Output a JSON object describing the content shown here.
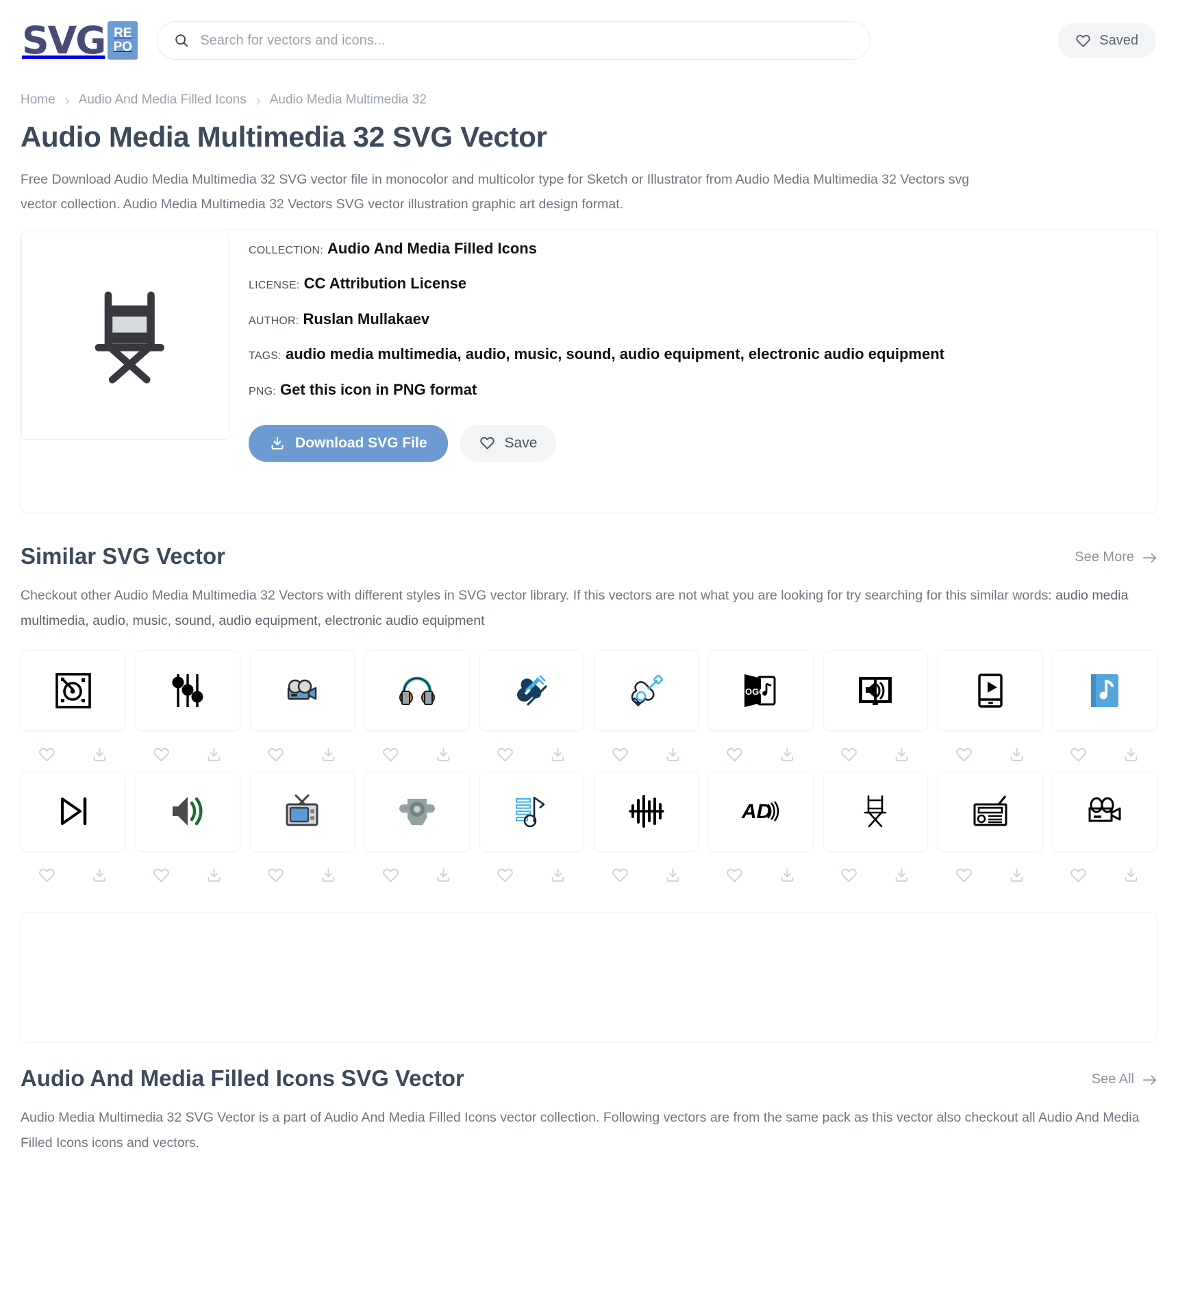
{
  "header": {
    "logo_text": "SVG",
    "logo_badge_top": "RE",
    "logo_badge_bottom": "PO",
    "search_placeholder": "Search for vectors and icons...",
    "search_value": "",
    "saved_label": "Saved"
  },
  "breadcrumb": {
    "home": "Home",
    "collection": "Audio And Media Filled Icons",
    "current": "Audio Media Multimedia 32"
  },
  "page": {
    "title": "Audio Media Multimedia 32 SVG Vector",
    "description": "Free Download Audio Media Multimedia 32 SVG vector file in monocolor and multicolor type for Sketch or Illustrator from Audio Media Multimedia 32 Vectors svg vector collection. Audio Media Multimedia 32 Vectors SVG vector illustration graphic art design format."
  },
  "detail": {
    "collection_label": "COLLECTION:",
    "collection_value": "Audio And Media Filled Icons",
    "license_label": "LICENSE:",
    "license_value": "CC Attribution License",
    "author_label": "AUTHOR:",
    "author_value": "Ruslan Mullakaev",
    "tags_label": "TAGS:",
    "tags_value": "audio media multimedia, audio, music, sound, audio equipment, electronic audio equipment",
    "png_label": "PNG:",
    "png_value": "Get this icon in PNG format",
    "download_label": "Download SVG File",
    "save_label": "Save",
    "preview_icon": "directors-chair-icon"
  },
  "similar": {
    "title": "Similar SVG Vector",
    "see_more": "See More",
    "description_part1": "Checkout other Audio Media Multimedia 32 Vectors with different styles in SVG vector library. If this vectors are not what you are looking for try searching for this similar words: ",
    "description_keywords": "audio media multimedia, audio, music, sound, audio equipment, electronic audio equipment",
    "icons": [
      {
        "name": "turntable-icon"
      },
      {
        "name": "equalizer-sliders-icon"
      },
      {
        "name": "video-camera-icon"
      },
      {
        "name": "headphones-icon"
      },
      {
        "name": "violin-icon"
      },
      {
        "name": "acoustic-guitar-icon"
      },
      {
        "name": "ogg-audio-file-icon"
      },
      {
        "name": "audio-book-speaker-icon"
      },
      {
        "name": "tablet-video-play-icon"
      },
      {
        "name": "music-note-book-icon"
      },
      {
        "name": "play-next-track-icon"
      },
      {
        "name": "volume-speaker-icon"
      },
      {
        "name": "retro-television-icon"
      },
      {
        "name": "audio-jack-connector-icon"
      },
      {
        "name": "music-playlist-note-icon"
      },
      {
        "name": "audio-waveform-icon"
      },
      {
        "name": "audio-description-icon"
      },
      {
        "name": "directors-chair-icon"
      },
      {
        "name": "radio-receiver-icon"
      },
      {
        "name": "movie-camera-outline-icon"
      }
    ],
    "favorite_label": "Favorite",
    "download_label": "Download"
  },
  "collection_section": {
    "title": "Audio And Media Filled Icons SVG Vector",
    "see_all": "See All",
    "description": "Audio Media Multimedia 32 SVG Vector is a part of Audio And Media Filled Icons vector collection. Following vectors are from the same pack as this vector also checkout all Audio And Media Filled Icons icons and vectors."
  },
  "colors": {
    "brand_navy": "#474b77",
    "brand_blue": "#6c9bd2",
    "heading": "#3c4a5b",
    "body_text": "#6f7680",
    "muted": "#9aa2ad"
  }
}
